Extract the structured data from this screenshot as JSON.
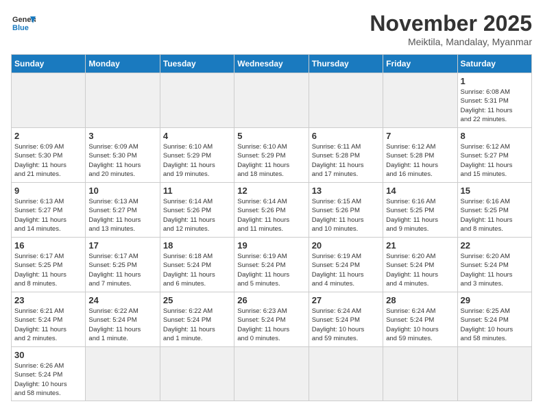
{
  "header": {
    "logo_general": "General",
    "logo_blue": "Blue",
    "title": "November 2025",
    "subtitle": "Meiktila, Mandalay, Myanmar"
  },
  "weekdays": [
    "Sunday",
    "Monday",
    "Tuesday",
    "Wednesday",
    "Thursday",
    "Friday",
    "Saturday"
  ],
  "weeks": [
    [
      {
        "day": "",
        "info": "",
        "empty": true
      },
      {
        "day": "",
        "info": "",
        "empty": true
      },
      {
        "day": "",
        "info": "",
        "empty": true
      },
      {
        "day": "",
        "info": "",
        "empty": true
      },
      {
        "day": "",
        "info": "",
        "empty": true
      },
      {
        "day": "",
        "info": "",
        "empty": true
      },
      {
        "day": "1",
        "info": "Sunrise: 6:08 AM\nSunset: 5:31 PM\nDaylight: 11 hours\nand 22 minutes."
      }
    ],
    [
      {
        "day": "2",
        "info": "Sunrise: 6:09 AM\nSunset: 5:30 PM\nDaylight: 11 hours\nand 21 minutes."
      },
      {
        "day": "3",
        "info": "Sunrise: 6:09 AM\nSunset: 5:30 PM\nDaylight: 11 hours\nand 20 minutes."
      },
      {
        "day": "4",
        "info": "Sunrise: 6:10 AM\nSunset: 5:29 PM\nDaylight: 11 hours\nand 19 minutes."
      },
      {
        "day": "5",
        "info": "Sunrise: 6:10 AM\nSunset: 5:29 PM\nDaylight: 11 hours\nand 18 minutes."
      },
      {
        "day": "6",
        "info": "Sunrise: 6:11 AM\nSunset: 5:28 PM\nDaylight: 11 hours\nand 17 minutes."
      },
      {
        "day": "7",
        "info": "Sunrise: 6:12 AM\nSunset: 5:28 PM\nDaylight: 11 hours\nand 16 minutes."
      },
      {
        "day": "8",
        "info": "Sunrise: 6:12 AM\nSunset: 5:27 PM\nDaylight: 11 hours\nand 15 minutes."
      }
    ],
    [
      {
        "day": "9",
        "info": "Sunrise: 6:13 AM\nSunset: 5:27 PM\nDaylight: 11 hours\nand 14 minutes."
      },
      {
        "day": "10",
        "info": "Sunrise: 6:13 AM\nSunset: 5:27 PM\nDaylight: 11 hours\nand 13 minutes."
      },
      {
        "day": "11",
        "info": "Sunrise: 6:14 AM\nSunset: 5:26 PM\nDaylight: 11 hours\nand 12 minutes."
      },
      {
        "day": "12",
        "info": "Sunrise: 6:14 AM\nSunset: 5:26 PM\nDaylight: 11 hours\nand 11 minutes."
      },
      {
        "day": "13",
        "info": "Sunrise: 6:15 AM\nSunset: 5:26 PM\nDaylight: 11 hours\nand 10 minutes."
      },
      {
        "day": "14",
        "info": "Sunrise: 6:16 AM\nSunset: 5:25 PM\nDaylight: 11 hours\nand 9 minutes."
      },
      {
        "day": "15",
        "info": "Sunrise: 6:16 AM\nSunset: 5:25 PM\nDaylight: 11 hours\nand 8 minutes."
      }
    ],
    [
      {
        "day": "16",
        "info": "Sunrise: 6:17 AM\nSunset: 5:25 PM\nDaylight: 11 hours\nand 8 minutes."
      },
      {
        "day": "17",
        "info": "Sunrise: 6:17 AM\nSunset: 5:25 PM\nDaylight: 11 hours\nand 7 minutes."
      },
      {
        "day": "18",
        "info": "Sunrise: 6:18 AM\nSunset: 5:24 PM\nDaylight: 11 hours\nand 6 minutes."
      },
      {
        "day": "19",
        "info": "Sunrise: 6:19 AM\nSunset: 5:24 PM\nDaylight: 11 hours\nand 5 minutes."
      },
      {
        "day": "20",
        "info": "Sunrise: 6:19 AM\nSunset: 5:24 PM\nDaylight: 11 hours\nand 4 minutes."
      },
      {
        "day": "21",
        "info": "Sunrise: 6:20 AM\nSunset: 5:24 PM\nDaylight: 11 hours\nand 4 minutes."
      },
      {
        "day": "22",
        "info": "Sunrise: 6:20 AM\nSunset: 5:24 PM\nDaylight: 11 hours\nand 3 minutes."
      }
    ],
    [
      {
        "day": "23",
        "info": "Sunrise: 6:21 AM\nSunset: 5:24 PM\nDaylight: 11 hours\nand 2 minutes."
      },
      {
        "day": "24",
        "info": "Sunrise: 6:22 AM\nSunset: 5:24 PM\nDaylight: 11 hours\nand 1 minute."
      },
      {
        "day": "25",
        "info": "Sunrise: 6:22 AM\nSunset: 5:24 PM\nDaylight: 11 hours\nand 1 minute."
      },
      {
        "day": "26",
        "info": "Sunrise: 6:23 AM\nSunset: 5:24 PM\nDaylight: 11 hours\nand 0 minutes."
      },
      {
        "day": "27",
        "info": "Sunrise: 6:24 AM\nSunset: 5:24 PM\nDaylight: 10 hours\nand 59 minutes."
      },
      {
        "day": "28",
        "info": "Sunrise: 6:24 AM\nSunset: 5:24 PM\nDaylight: 10 hours\nand 59 minutes."
      },
      {
        "day": "29",
        "info": "Sunrise: 6:25 AM\nSunset: 5:24 PM\nDaylight: 10 hours\nand 58 minutes."
      }
    ],
    [
      {
        "day": "30",
        "info": "Sunrise: 6:26 AM\nSunset: 5:24 PM\nDaylight: 10 hours\nand 58 minutes.",
        "last": true
      },
      {
        "day": "",
        "info": "",
        "empty": true,
        "last": true
      },
      {
        "day": "",
        "info": "",
        "empty": true,
        "last": true
      },
      {
        "day": "",
        "info": "",
        "empty": true,
        "last": true
      },
      {
        "day": "",
        "info": "",
        "empty": true,
        "last": true
      },
      {
        "day": "",
        "info": "",
        "empty": true,
        "last": true
      },
      {
        "day": "",
        "info": "",
        "empty": true,
        "last": true
      }
    ]
  ]
}
